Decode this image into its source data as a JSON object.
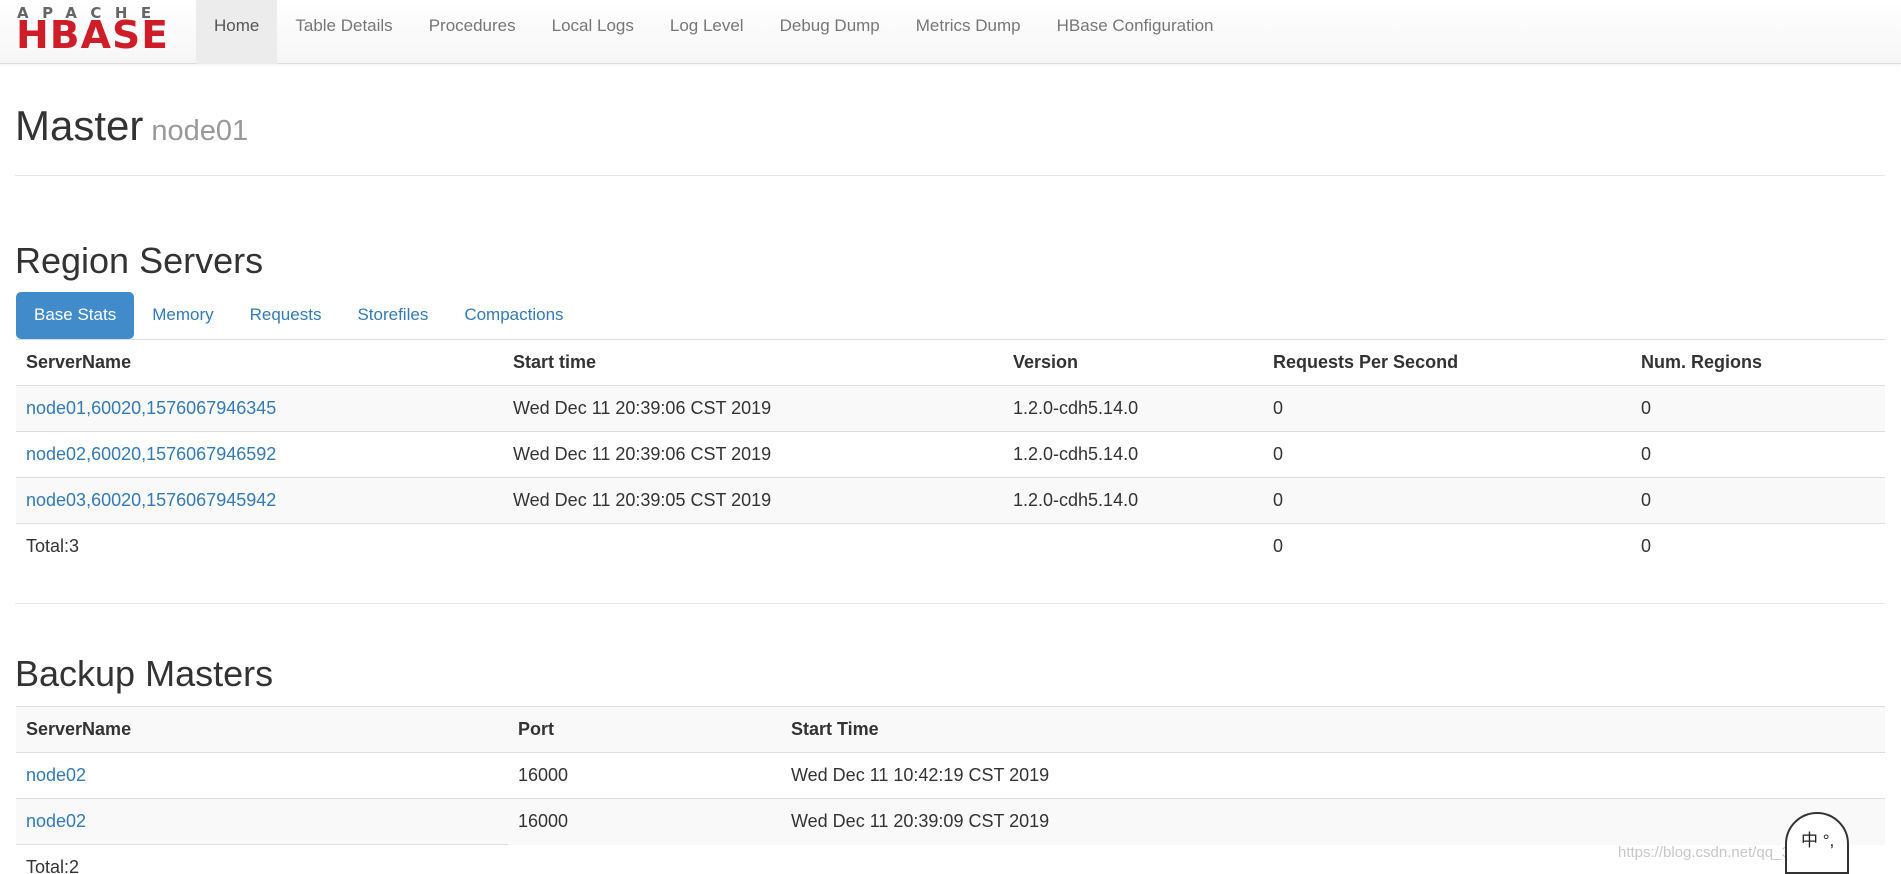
{
  "brand": {
    "top": "APACHE",
    "name": "HBASE"
  },
  "nav": [
    "Home",
    "Table Details",
    "Procedures",
    "Local Logs",
    "Log Level",
    "Debug Dump",
    "Metrics Dump",
    "HBase Configuration"
  ],
  "master": {
    "title": "Master",
    "host": "node01"
  },
  "region_servers": {
    "heading": "Region Servers",
    "tabs": [
      "Base Stats",
      "Memory",
      "Requests",
      "Storefiles",
      "Compactions"
    ],
    "columns": [
      "ServerName",
      "Start time",
      "Version",
      "Requests Per Second",
      "Num. Regions"
    ],
    "rows": [
      {
        "server": "node01,60020,1576067946345",
        "start": "Wed Dec 11 20:39:06 CST 2019",
        "version": "1.2.0-cdh5.14.0",
        "rps": "0",
        "regions": "0"
      },
      {
        "server": "node02,60020,1576067946592",
        "start": "Wed Dec 11 20:39:06 CST 2019",
        "version": "1.2.0-cdh5.14.0",
        "rps": "0",
        "regions": "0"
      },
      {
        "server": "node03,60020,1576067945942",
        "start": "Wed Dec 11 20:39:05 CST 2019",
        "version": "1.2.0-cdh5.14.0",
        "rps": "0",
        "regions": "0"
      }
    ],
    "total": {
      "label": "Total:3",
      "rps": "0",
      "regions": "0"
    }
  },
  "backup_masters": {
    "heading": "Backup Masters",
    "columns": [
      "ServerName",
      "Port",
      "Start Time"
    ],
    "rows": [
      {
        "server": "node02",
        "port": "16000",
        "start": "Wed Dec 11 10:42:19 CST 2019"
      },
      {
        "server": "node02",
        "port": "16000",
        "start": "Wed Dec 11 20:39:09 CST 2019"
      }
    ],
    "total": "Total:2"
  },
  "watermark": "https://blog.csdn.net/qq_36049011",
  "ime_label": "中 °,"
}
